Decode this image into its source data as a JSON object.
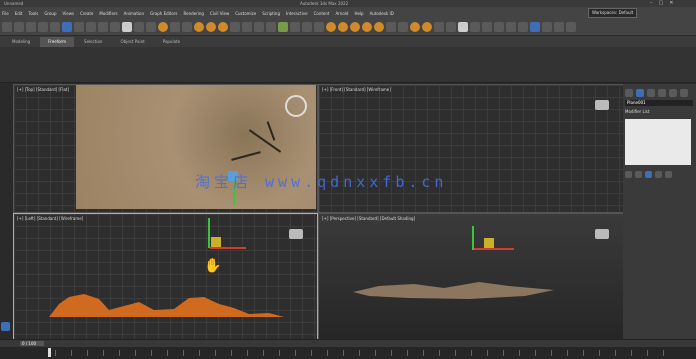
{
  "window": {
    "app_label": "Unnamed",
    "title": "Autodesk 3ds Max 2022"
  },
  "menu": [
    "File",
    "Edit",
    "Tools",
    "Group",
    "Views",
    "Create",
    "Modifiers",
    "Animation",
    "Graph Editors",
    "Rendering",
    "Civil View",
    "Customize",
    "Scripting",
    "Interactive",
    "Content",
    "Arnold",
    "Help",
    "Autodesk ID"
  ],
  "workspace": {
    "label": "Workspaces",
    "value": "Default"
  },
  "ribbon_tabs": [
    {
      "label": "Modeling",
      "active": false
    },
    {
      "label": "Freeform",
      "active": true
    },
    {
      "label": "Selection",
      "active": false
    },
    {
      "label": "Object Paint",
      "active": false
    },
    {
      "label": "Populate",
      "active": false
    }
  ],
  "viewports": {
    "top": "[+] [Top] [Standard] [Flat]",
    "front": "[+] [Front] [Standard] [Wireframe]",
    "left": "[+] [Left] [Standard] [Wireframe]",
    "perspective": "[+] [Perspective] [Standard] [Default Shading]"
  },
  "command_panel": {
    "object_name": "Plane001",
    "modifier_list": "Modifier List"
  },
  "timeline": {
    "frame": "0 / 100"
  },
  "watermark": "淘宝店 www.qdnxxfb.cn",
  "colors": {
    "accent": "#d8b030",
    "terrain": "#a99073",
    "x_axis": "#d83a2a",
    "y_axis": "#3cc43c"
  }
}
